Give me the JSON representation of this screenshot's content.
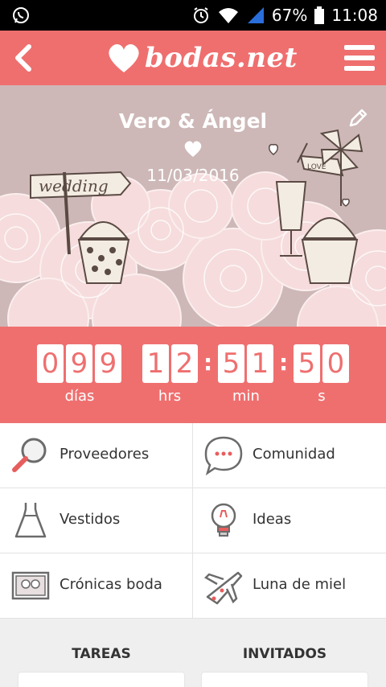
{
  "status": {
    "battery": "67%",
    "time": "11:08",
    "icons": [
      "whatsapp-icon",
      "alarm-icon",
      "wifi-icon",
      "signal-icon",
      "battery-icon"
    ]
  },
  "appbar": {
    "brand": "bodas.net",
    "back_icon": "chevron-left-icon",
    "menu_icon": "hamburger-menu-icon"
  },
  "hero": {
    "names": "Vero & Ángel",
    "date": "11/03/2016",
    "sign_text": "wedding",
    "flag_text": "LOVE"
  },
  "countdown": {
    "days": [
      "0",
      "9",
      "9"
    ],
    "hours": [
      "1",
      "2"
    ],
    "minutes": [
      "5",
      "1"
    ],
    "seconds": [
      "5",
      "0"
    ],
    "labels": {
      "days": "días",
      "hours": "hrs",
      "minutes": "min",
      "seconds": "s"
    }
  },
  "menu": {
    "items": [
      {
        "label": "Proveedores",
        "icon": "magnifier-icon"
      },
      {
        "label": "Comunidad",
        "icon": "chat-bubble-icon"
      },
      {
        "label": "Vestidos",
        "icon": "dress-icon"
      },
      {
        "label": "Ideas",
        "icon": "lightbulb-icon"
      },
      {
        "label": "Crónicas boda",
        "icon": "photos-icon"
      },
      {
        "label": "Luna de miel",
        "icon": "airplane-icon"
      }
    ]
  },
  "tabs": {
    "tareas": "TAREAS",
    "invitados": "INVITADOS"
  },
  "colors": {
    "brand": "#ef6f6f",
    "hero_bg": "#cdb8b7",
    "text": "#333333"
  }
}
